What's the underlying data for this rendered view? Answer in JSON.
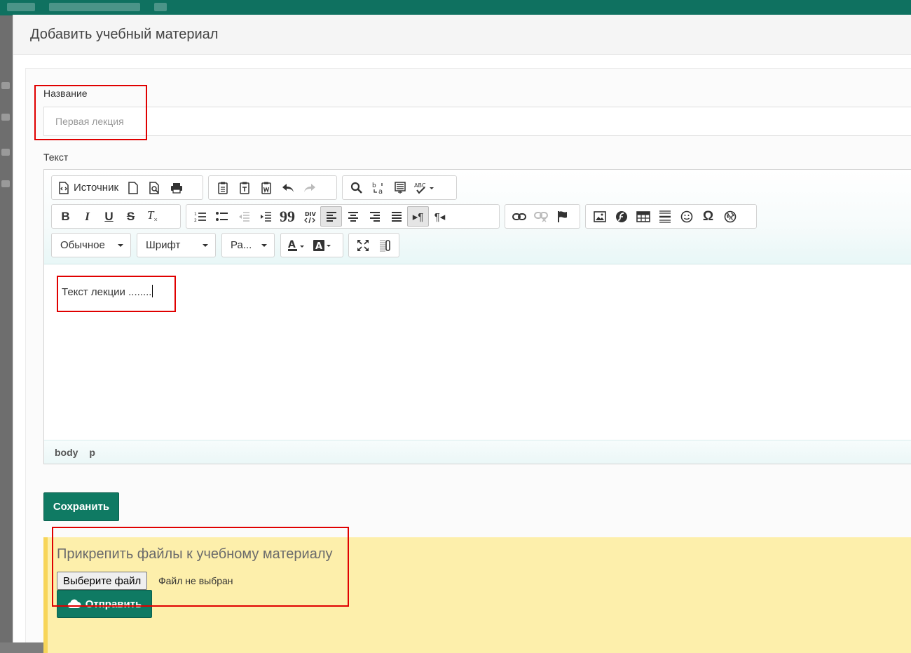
{
  "modal": {
    "title": "Добавить учебный материал"
  },
  "form": {
    "title_label": "Название",
    "title_value": "Первая лекция",
    "text_label": "Текст"
  },
  "editor": {
    "toolbar": {
      "source_label": "Источник",
      "format_combo": "Обычное",
      "font_combo": "Шрифт",
      "size_combo": "Ра..."
    },
    "content": "Текст лекции ........",
    "path": [
      "body",
      "p"
    ]
  },
  "actions": {
    "save_label": "Сохранить"
  },
  "attachments": {
    "title": "Прикрепить файлы к учебному материалу",
    "choose_file_label": "Выберите файл",
    "file_status": "Файл не выбран",
    "send_label": "Отправить"
  },
  "colors": {
    "primary": "#0f7a63",
    "attach_bg": "#fdefab",
    "attach_border": "#f7d559",
    "highlight": "#e00000"
  }
}
